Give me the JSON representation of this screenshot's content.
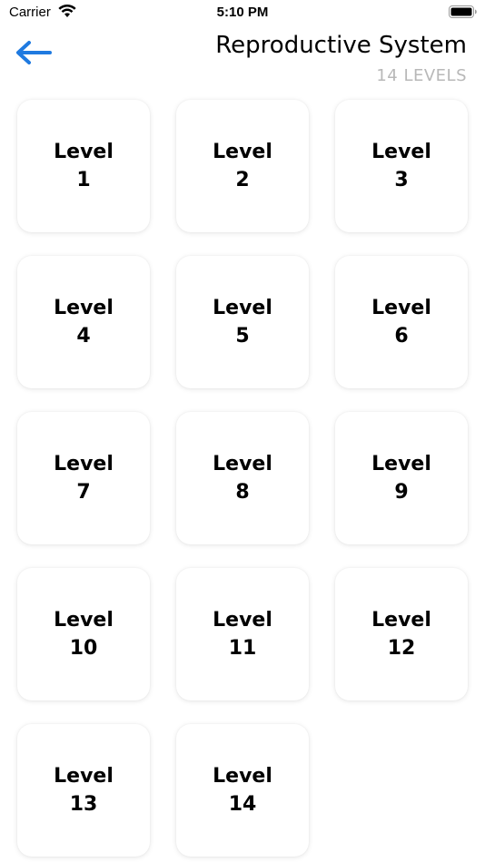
{
  "status_bar": {
    "carrier": "Carrier",
    "time": "5:10 PM",
    "wifi_icon": "wifi-icon",
    "battery_icon": "battery-icon"
  },
  "header": {
    "back_icon": "arrow-left-icon",
    "title": "Reproductive System",
    "subtitle": "14 LEVELS"
  },
  "colors": {
    "accent": "#1f7ae0",
    "subtitle": "#b8b8b8"
  },
  "levels": [
    {
      "label": "Level",
      "number": "1"
    },
    {
      "label": "Level",
      "number": "2"
    },
    {
      "label": "Level",
      "number": "3"
    },
    {
      "label": "Level",
      "number": "4"
    },
    {
      "label": "Level",
      "number": "5"
    },
    {
      "label": "Level",
      "number": "6"
    },
    {
      "label": "Level",
      "number": "7"
    },
    {
      "label": "Level",
      "number": "8"
    },
    {
      "label": "Level",
      "number": "9"
    },
    {
      "label": "Level",
      "number": "10"
    },
    {
      "label": "Level",
      "number": "11"
    },
    {
      "label": "Level",
      "number": "12"
    },
    {
      "label": "Level",
      "number": "13"
    },
    {
      "label": "Level",
      "number": "14"
    }
  ]
}
